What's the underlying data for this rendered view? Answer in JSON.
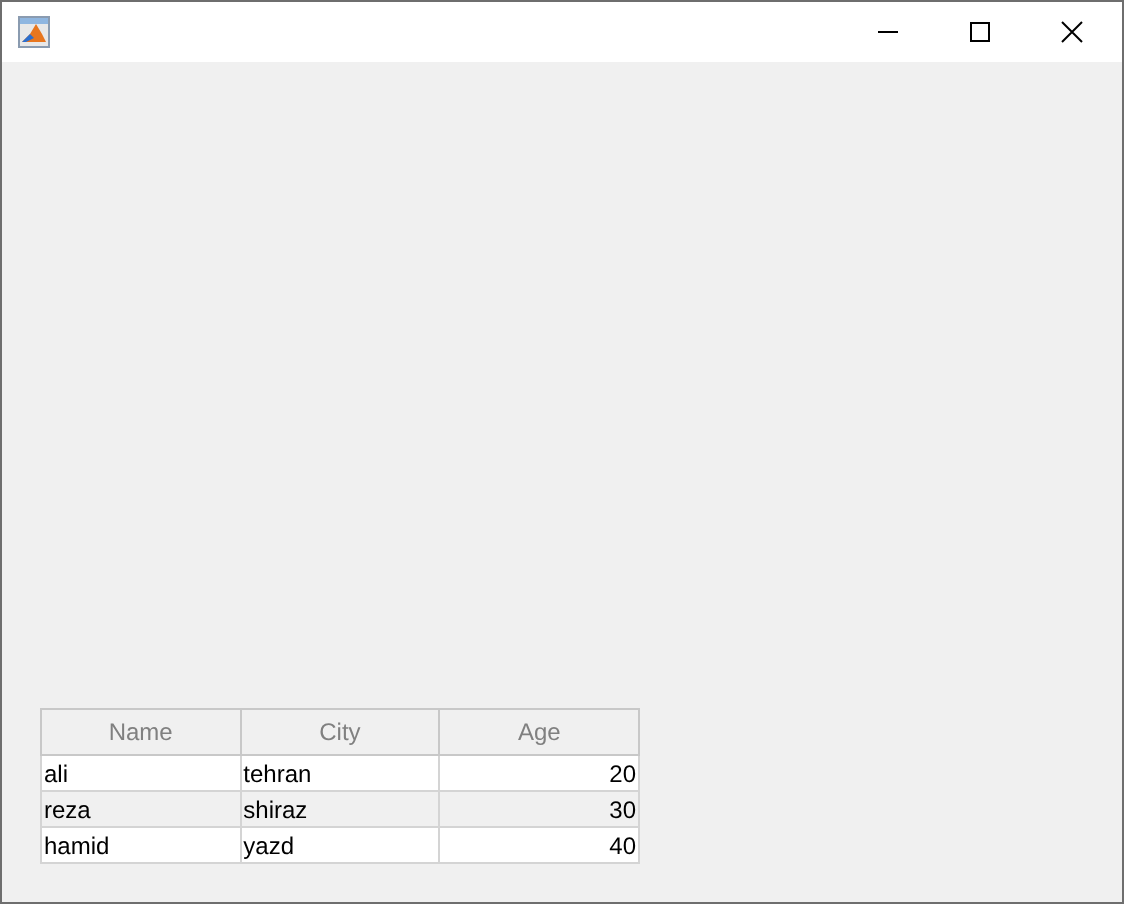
{
  "table": {
    "columns": [
      {
        "label": "Name",
        "kind": "text"
      },
      {
        "label": "City",
        "kind": "text"
      },
      {
        "label": "Age",
        "kind": "number"
      }
    ],
    "rows": [
      [
        "ali",
        "tehran",
        "20"
      ],
      [
        "reza",
        "shiraz",
        "30"
      ],
      [
        "hamid",
        "yazd",
        "40"
      ]
    ]
  }
}
